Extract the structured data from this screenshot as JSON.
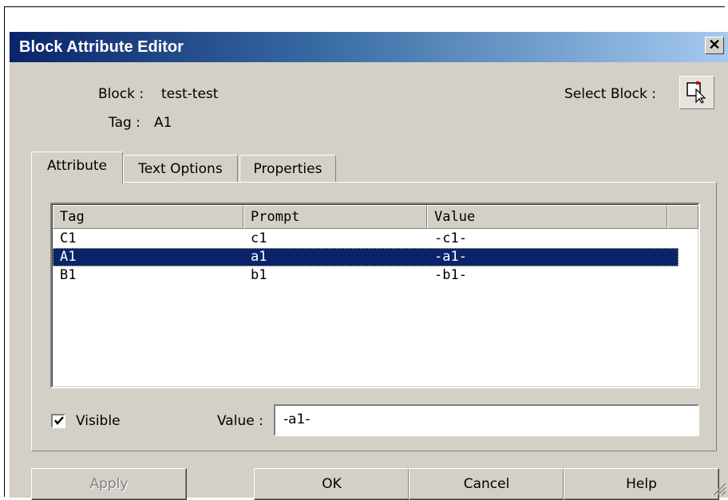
{
  "window": {
    "title": "Block Attribute Editor",
    "close_icon": "close-icon"
  },
  "header": {
    "block_label": "Block :",
    "block_value": "test-test",
    "tag_label": "Tag :",
    "tag_value": "A1",
    "select_block_label": "Select Block :",
    "select_block_icon": "select-object-icon"
  },
  "tabs": [
    {
      "label": "Attribute",
      "active": true
    },
    {
      "label": "Text Options",
      "active": false
    },
    {
      "label": "Properties",
      "active": false
    }
  ],
  "attribute_list": {
    "columns": [
      "Tag",
      "Prompt",
      "Value"
    ],
    "rows": [
      {
        "tag": "C1",
        "prompt": "c1",
        "value": "-c1-",
        "selected": false
      },
      {
        "tag": "A1",
        "prompt": "a1",
        "value": "-a1-",
        "selected": true
      },
      {
        "tag": "B1",
        "prompt": "b1",
        "value": "-b1-",
        "selected": false
      }
    ]
  },
  "visible": {
    "label": "Visible",
    "checked": true
  },
  "value_field": {
    "label": "Value :",
    "value": "-a1-"
  },
  "buttons": {
    "apply": {
      "label": "Apply",
      "enabled": false
    },
    "ok": {
      "label": "OK",
      "enabled": true
    },
    "cancel": {
      "label": "Cancel",
      "enabled": true
    },
    "help": {
      "label": "Help",
      "enabled": true
    }
  },
  "colors": {
    "titlebar_start": "#0a246a",
    "titlebar_end": "#a6caf0",
    "dialog_bg": "#d4d0c8",
    "selection_bg": "#0a246a",
    "disabled_text": "#808080"
  }
}
